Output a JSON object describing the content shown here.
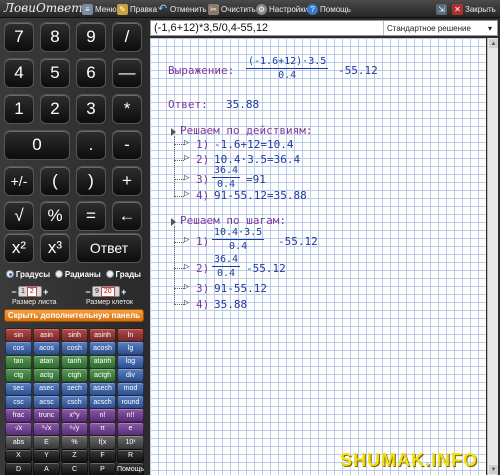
{
  "toolbar": {
    "logo": "ЛовиОтвет",
    "menu": "Меню",
    "edit": "Правка",
    "undo": "Отменить",
    "clear": "Очистить",
    "settings": "Настройки",
    "help": "Помощь",
    "close": "Закрыть"
  },
  "keypad": {
    "k7": "7",
    "k8": "8",
    "k9": "9",
    "div": "/",
    "k4": "4",
    "k5": "5",
    "k6": "6",
    "minus": "—",
    "k1": "1",
    "k2": "2",
    "k3": "3",
    "mul": "*",
    "k0": "0",
    "dot": ".",
    "sub": "-",
    "sign": "+/-",
    "lpar": "(",
    "rpar": ")",
    "plus": "+",
    "sqrt": "√",
    "pct": "%",
    "eq": "=",
    "back": "←",
    "sq": "x²",
    "cube": "x³",
    "answer": "Ответ"
  },
  "angle": {
    "deg": "Градусы",
    "rad": "Радианы",
    "grad": "Грады",
    "selected": "deg"
  },
  "sheet": {
    "label": "Размер листа",
    "left": "1",
    "value": "2"
  },
  "cells": {
    "label": "Размер клеток",
    "left": "9",
    "value": "20"
  },
  "ext_panel_button": "Скрыть дополнительную панель",
  "functions": [
    [
      "sin",
      "asin",
      "sinh",
      "asinh",
      "ln"
    ],
    [
      "cos",
      "acos",
      "cosh",
      "acosh",
      "lg"
    ],
    [
      "tan",
      "atan",
      "tanh",
      "atanh",
      "log"
    ],
    [
      "ctg",
      "actg",
      "ctgh",
      "actgh",
      "div"
    ],
    [
      "sec",
      "asec",
      "sech",
      "asech",
      "mod"
    ],
    [
      "csc",
      "acsc",
      "csch",
      "acsch",
      "round"
    ],
    [
      "frac",
      "trunc",
      "x^y",
      "n!",
      "n!!"
    ],
    [
      "√x",
      "³√x",
      "ˣ√y",
      "π",
      "e"
    ],
    [
      "abs",
      "E",
      "%",
      "f(x",
      "10ˣ"
    ],
    [
      "X",
      "Y",
      "Z",
      "F",
      "R"
    ],
    [
      "D",
      "A",
      "C",
      "P",
      "Помощь"
    ]
  ],
  "expression": "(-1,6+12)*3,5/0,4-55,12",
  "mode": "Стандартное решение",
  "solution": {
    "expr_label": "Выражение:",
    "expr_num": "(-1.6+12)·3.5",
    "expr_den": "0.4",
    "expr_tail": "-55.12",
    "answer_label": "Ответ:",
    "answer_value": "35.88",
    "by_actions_title": "Решаем по действиям:",
    "a1_num": "1)",
    "a1": "-1.6+12=10.4",
    "a2_num": "2)",
    "a2": "10.4·3.5=36.4",
    "a3_num": "3)",
    "a3_n": "36.4",
    "a3_d": "0.4",
    "a3_r": "=91",
    "a4_num": "4)",
    "a4": "91-55.12=35.88",
    "by_steps_title": "Решаем по шагам:",
    "s1_num": "1)",
    "s1_n": "10.4·3.5",
    "s1_d": "0.4",
    "s1_r": "-55.12",
    "s2_num": "2)",
    "s2_n": "36.4",
    "s2_d": "0.4",
    "s2_r": "-55.12",
    "s3_num": "3)",
    "s3": "91-55.12",
    "s4_num": "4)",
    "s4": "35.88"
  },
  "watermark": "SHUMAK.INFO"
}
